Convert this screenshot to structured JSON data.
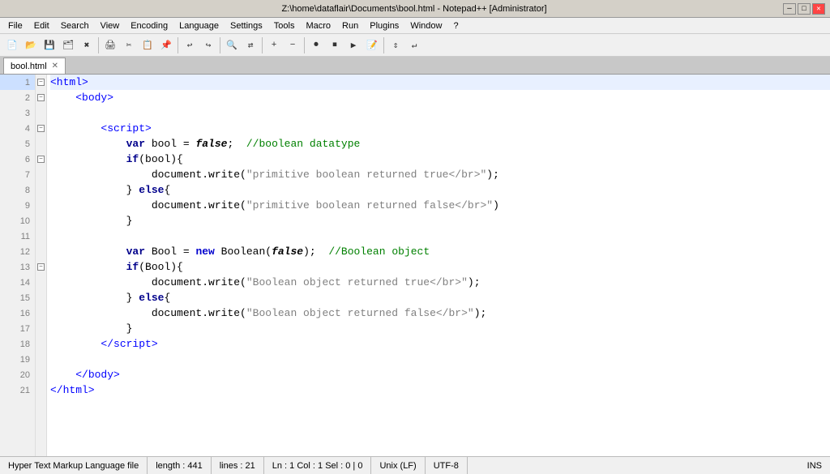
{
  "titleBar": {
    "title": "Z:\\home\\dataflair\\Documents\\bool.html - Notepad++ [Administrator]",
    "controls": [
      "─",
      "□",
      "✕"
    ]
  },
  "menuBar": {
    "items": [
      "File",
      "Edit",
      "Search",
      "View",
      "Encoding",
      "Language",
      "Settings",
      "Tools",
      "Macro",
      "Run",
      "Plugins",
      "Window",
      "?"
    ]
  },
  "tabs": [
    {
      "label": "bool.html",
      "active": true
    }
  ],
  "statusBar": {
    "fileType": "Hyper Text Markup Language file",
    "length": "length : 441",
    "lines": "lines : 21",
    "position": "Ln : 1   Col : 1   Sel : 0 | 0",
    "lineEnding": "Unix (LF)",
    "encoding": "UTF-8",
    "mode": "INS"
  },
  "lines": [
    {
      "num": 1,
      "fold": "minus",
      "highlighted": true
    },
    {
      "num": 2,
      "fold": "minus",
      "highlighted": false
    },
    {
      "num": 3,
      "fold": null,
      "highlighted": false
    },
    {
      "num": 4,
      "fold": "minus",
      "highlighted": false
    },
    {
      "num": 5,
      "fold": null,
      "highlighted": false
    },
    {
      "num": 6,
      "fold": "minus",
      "highlighted": false
    },
    {
      "num": 7,
      "fold": null,
      "highlighted": false
    },
    {
      "num": 8,
      "fold": null,
      "highlighted": false
    },
    {
      "num": 9,
      "fold": null,
      "highlighted": false
    },
    {
      "num": 10,
      "fold": null,
      "highlighted": false
    },
    {
      "num": 11,
      "fold": null,
      "highlighted": false
    },
    {
      "num": 12,
      "fold": null,
      "highlighted": false
    },
    {
      "num": 13,
      "fold": "minus",
      "highlighted": false
    },
    {
      "num": 14,
      "fold": null,
      "highlighted": false
    },
    {
      "num": 15,
      "fold": null,
      "highlighted": false
    },
    {
      "num": 16,
      "fold": null,
      "highlighted": false
    },
    {
      "num": 17,
      "fold": null,
      "highlighted": false
    },
    {
      "num": 18,
      "fold": null,
      "highlighted": false
    },
    {
      "num": 19,
      "fold": null,
      "highlighted": false
    },
    {
      "num": 20,
      "fold": null,
      "highlighted": false
    },
    {
      "num": 21,
      "fold": null,
      "highlighted": false
    }
  ]
}
